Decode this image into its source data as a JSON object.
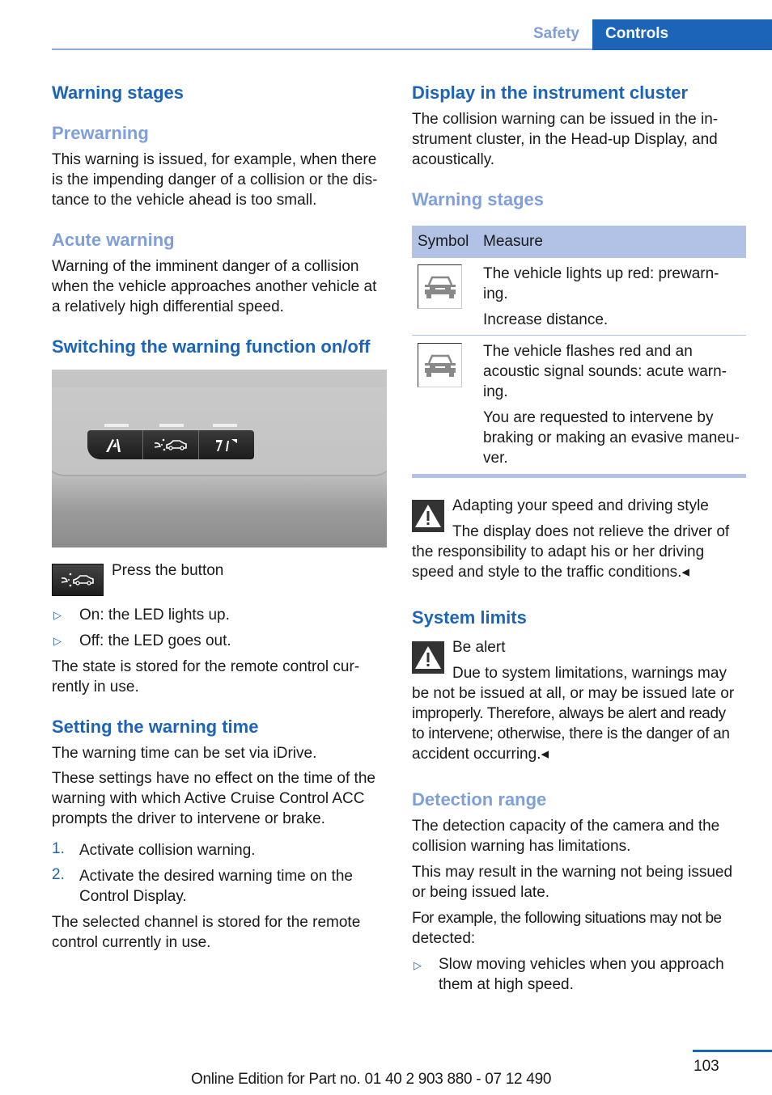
{
  "header": {
    "tabs": [
      {
        "label": "Safety",
        "active": false
      },
      {
        "label": "Controls",
        "active": true
      }
    ],
    "accent_color": "#1c64b8",
    "secondary_color": "#7f9fdb"
  },
  "left": {
    "warning_stages_title": "Warning stages",
    "prewarning": {
      "title": "Prewarning",
      "lines": [
        "This warning is issued, for example, when there",
        "is the impending danger of a collision or the dis-",
        "tance to the vehicle ahead is too small."
      ]
    },
    "acute": {
      "title": "Acute warning",
      "lines": [
        "Warning of the imminent danger of a collision",
        "when the vehicle approaches another vehicle at",
        "a relatively high differential speed."
      ]
    },
    "switching": {
      "title": "Switching the warning function on/off",
      "photo_icon": "button-panel-photo",
      "press_label": "Press the button",
      "bullets": [
        "On: the LED lights up.",
        "Off: the LED goes out."
      ],
      "state_lines": [
        "The state is stored for the remote control cur-",
        "rently in use."
      ]
    },
    "warning_time": {
      "title": "Setting the warning time",
      "intro": "The warning time can be set via iDrive.",
      "note_lines": [
        "These settings have no effect on the time of the",
        "warning with which Active Cruise Control ACC",
        "prompts the driver to intervene or brake."
      ],
      "steps": [
        {
          "num": "1.",
          "lines": [
            "Activate collision warning."
          ]
        },
        {
          "num": "2.",
          "lines": [
            "Activate the desired warning time on the",
            "Control Display."
          ]
        }
      ],
      "closing_lines": [
        "The selected channel is stored for the remote",
        "control currently in use."
      ]
    }
  },
  "right": {
    "display": {
      "title": "Display in the instrument cluster",
      "lines": [
        "The collision warning can be issued in the in-",
        "strument cluster, in the Head-up Display, and",
        "acoustically."
      ]
    },
    "warning_stages_title": "Warning stages",
    "table": {
      "headers": [
        "Symbol",
        "Measure"
      ],
      "rows": [
        {
          "symbol": "vehicle-icon",
          "paragraphs": [
            [
              "The vehicle lights up red: prewarn-",
              "ing."
            ],
            [
              "Increase distance."
            ]
          ]
        },
        {
          "symbol": "vehicle-icon",
          "paragraphs": [
            [
              "The vehicle flashes red and an",
              "acoustic signal sounds: acute warn-",
              "ing."
            ],
            [
              "You are requested to intervene by",
              "braking or making an evasive maneu-",
              "ver."
            ]
          ]
        }
      ]
    },
    "caution1": {
      "title": "Adapting your speed and driving style",
      "lines": [
        "The display does not relieve the driver of",
        "the responsibility to adapt his or her driving",
        "speed and style to the traffic conditions.◂"
      ]
    },
    "system_limits": {
      "title": "System limits",
      "caution_title": "Be alert",
      "lines": [
        "Due to system limitations, warnings may",
        "be not be issued at all, or may be issued late or",
        "improperly. Therefore, always be alert and ready",
        "to intervene; otherwise, there is the danger of an",
        "accident occurring.◂"
      ]
    },
    "detection": {
      "title": "Detection range",
      "p1": [
        "The detection capacity of the camera and the",
        "collision warning has limitations."
      ],
      "p2": [
        "This may result in the warning not being issued",
        "or being issued late."
      ],
      "p3": [
        "For example, the following situations may not be",
        "detected:"
      ],
      "bullets": [
        [
          "Slow moving vehicles when you approach",
          "them at high speed."
        ]
      ]
    }
  },
  "footer": {
    "page_number": "103",
    "edition": "Online Edition for Part no. 01 40 2 903 880 - 07 12 490"
  }
}
